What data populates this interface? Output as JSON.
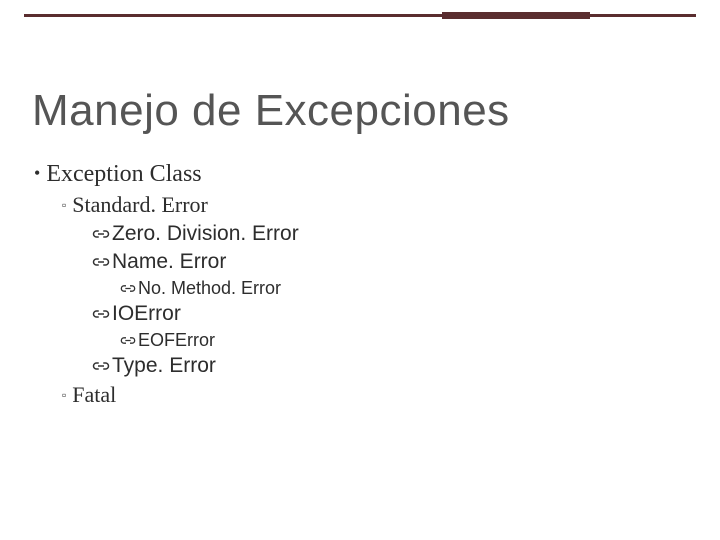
{
  "title": "Manejo de Excepciones",
  "bullets": {
    "exception_class": "Exception Class",
    "standard_error": "Standard. Error",
    "zero_division_error": "Zero. Division. Error",
    "name_error": "Name. Error",
    "no_method_error": "No. Method. Error",
    "io_error": "IOError",
    "eof_error": "EOFError",
    "type_error": "Type. Error",
    "fatal": "Fatal"
  }
}
